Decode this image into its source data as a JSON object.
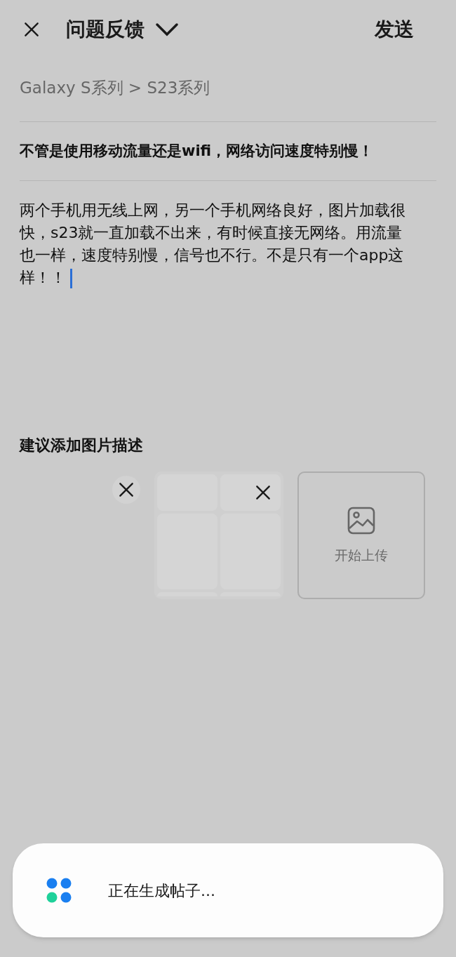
{
  "header": {
    "title": "问题反馈",
    "send": "发送"
  },
  "breadcrumb": "Galaxy S系列 > S23系列",
  "subject": "不管是使用移动流量还是wifi，网络访问速度特别慢！",
  "body": {
    "value": "两个手机用无线上网，另一个手机网络良好，图片加载很快，s23就一直加载不出来，有时候直接无网络。用流量也一样，速度特别慢，信号也不行。不是只有一个app这样！！",
    "focused": true
  },
  "attachments": {
    "label": "建议添加图片描述",
    "upload": "开始上传"
  },
  "toast": {
    "message": "正在生成帖子..."
  }
}
